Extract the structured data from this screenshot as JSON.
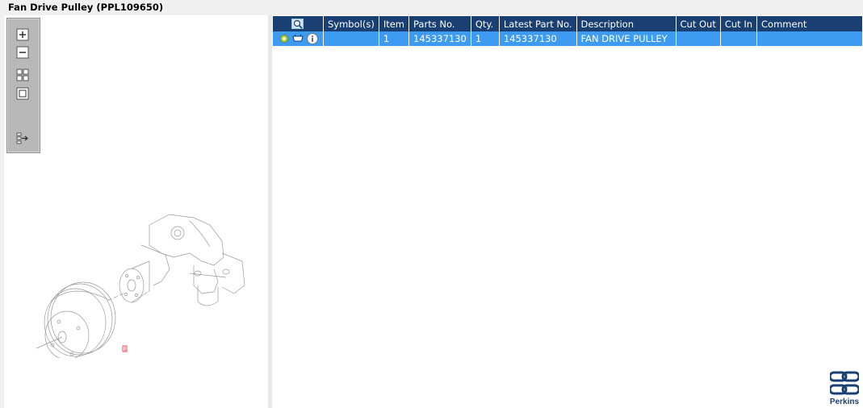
{
  "window": {
    "title": "Fan Drive Pulley (PPL109650)"
  },
  "toolbar": {
    "buttons": [
      "zoom-in",
      "zoom-out",
      "fit-all",
      "fit-window",
      "show-parts-list"
    ]
  },
  "drawing": {
    "callout": "1"
  },
  "table": {
    "columns": [
      "Symbol(s)",
      "Item",
      "Parts No.",
      "Qty.",
      "Latest Part No.",
      "Description",
      "Cut Out",
      "Cut In",
      "Comment"
    ],
    "rows": [
      {
        "symbols": "",
        "item": "1",
        "parts_no": "145337130",
        "qty": "1",
        "latest_part_no": "145337130",
        "description": "FAN DRIVE PULLEY",
        "cut_out": "",
        "cut_in": "",
        "comment": ""
      }
    ]
  },
  "logo": {
    "text": "Perkins"
  },
  "colors": {
    "header_bg": "#1a3f73",
    "selected_row": "#3d9bf2",
    "accent": "#1a3f73"
  }
}
